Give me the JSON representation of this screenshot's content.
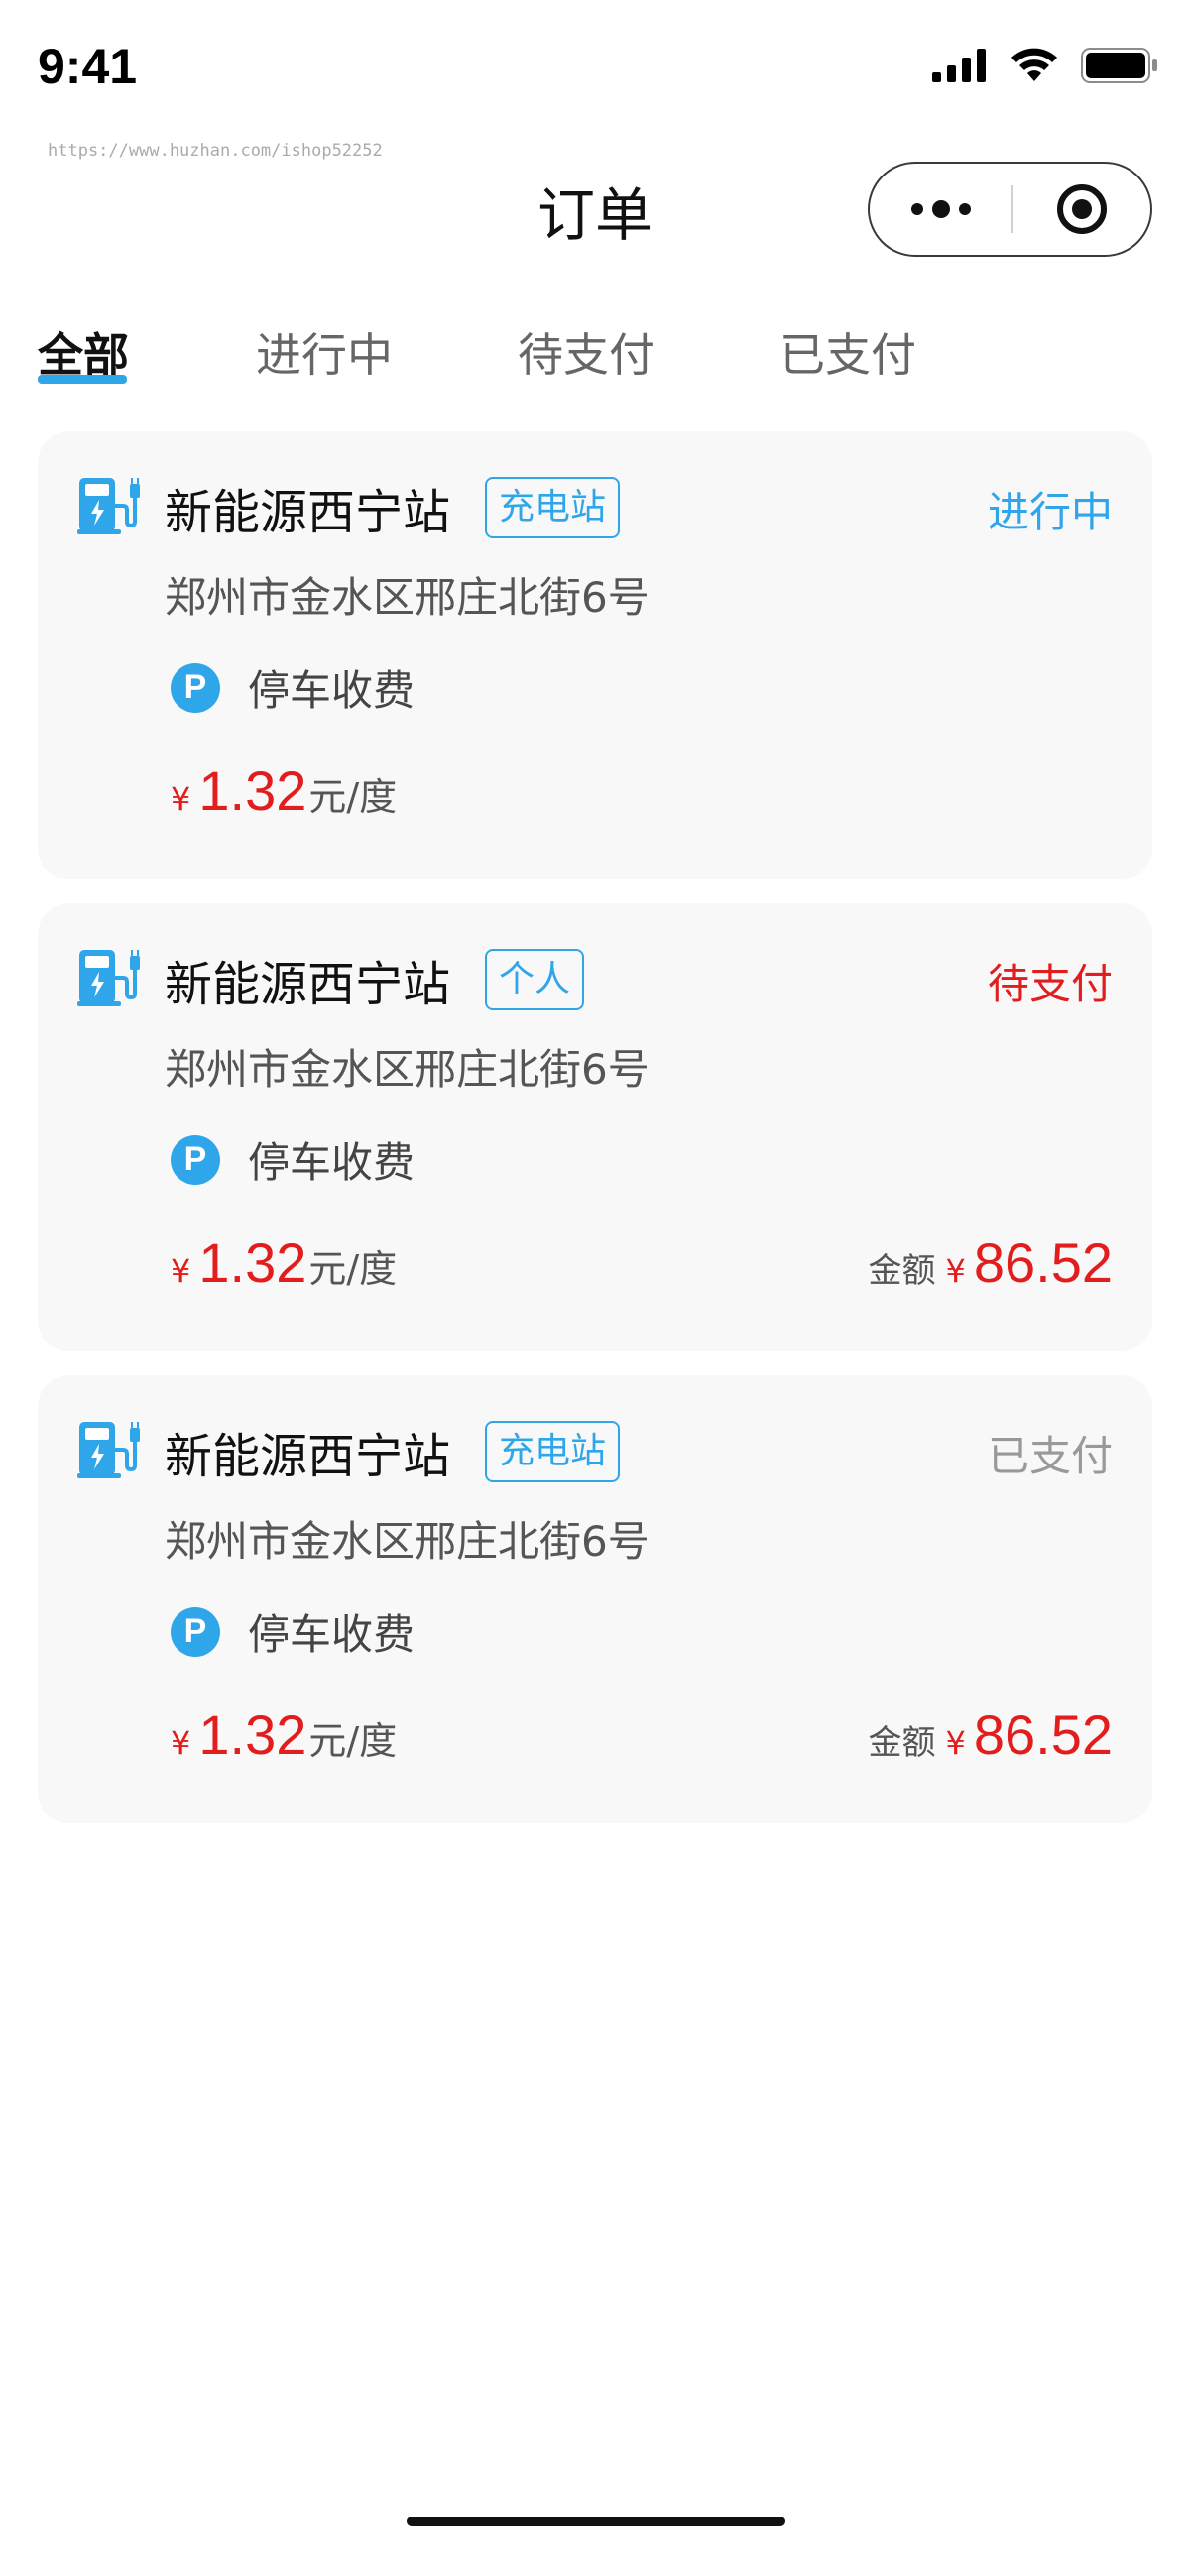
{
  "status_bar": {
    "time": "9:41"
  },
  "watermark": "https://www.huzhan.com/ishop52252",
  "nav": {
    "title": "订单"
  },
  "tabs": [
    {
      "label": "全部",
      "active": true
    },
    {
      "label": "进行中",
      "active": false
    },
    {
      "label": "待支付",
      "active": false
    },
    {
      "label": "已支付",
      "active": false
    }
  ],
  "orders": [
    {
      "station_name": "新能源西宁站",
      "tag": "充电站",
      "status": "进行中",
      "status_color": "#2fa6ea",
      "address": "郑州市金水区邢庄北街6号",
      "parking_icon": "P",
      "parking_label": "停车收费",
      "price_symbol": "¥",
      "price": "1.32",
      "price_unit": "元/度"
    },
    {
      "station_name": "新能源西宁站",
      "tag": "个人",
      "status": "待支付",
      "status_color": "#e21d1d",
      "address": "郑州市金水区邢庄北街6号",
      "parking_icon": "P",
      "parking_label": "停车收费",
      "price_symbol": "¥",
      "price": "1.32",
      "price_unit": "元/度",
      "amount_label": "金额",
      "amount_symbol": "¥",
      "amount": "86.52"
    },
    {
      "station_name": "新能源西宁站",
      "tag": "充电站",
      "status": "已支付",
      "status_color": "#999999",
      "address": "郑州市金水区邢庄北街6号",
      "parking_icon": "P",
      "parking_label": "停车收费",
      "price_symbol": "¥",
      "price": "1.32",
      "price_unit": "元/度",
      "amount_label": "金额",
      "amount_symbol": "¥",
      "amount": "86.52"
    }
  ],
  "colors": {
    "accent": "#2fa6ea",
    "price": "#e21d1d"
  }
}
